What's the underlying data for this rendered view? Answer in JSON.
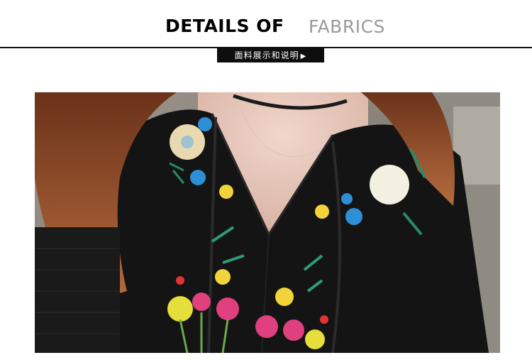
{
  "header": {
    "title_bold": "DETAILS OF",
    "title_light": "FABRICS",
    "tag_label": "面料展示和说明",
    "tag_arrow": "▶"
  },
  "photo": {
    "subject": "embroidered-black-blouse",
    "colors": {
      "blouse": "#141414",
      "skin": "#e7c8bd",
      "hair": "#8a4a2a",
      "background": "#8d8880"
    }
  }
}
